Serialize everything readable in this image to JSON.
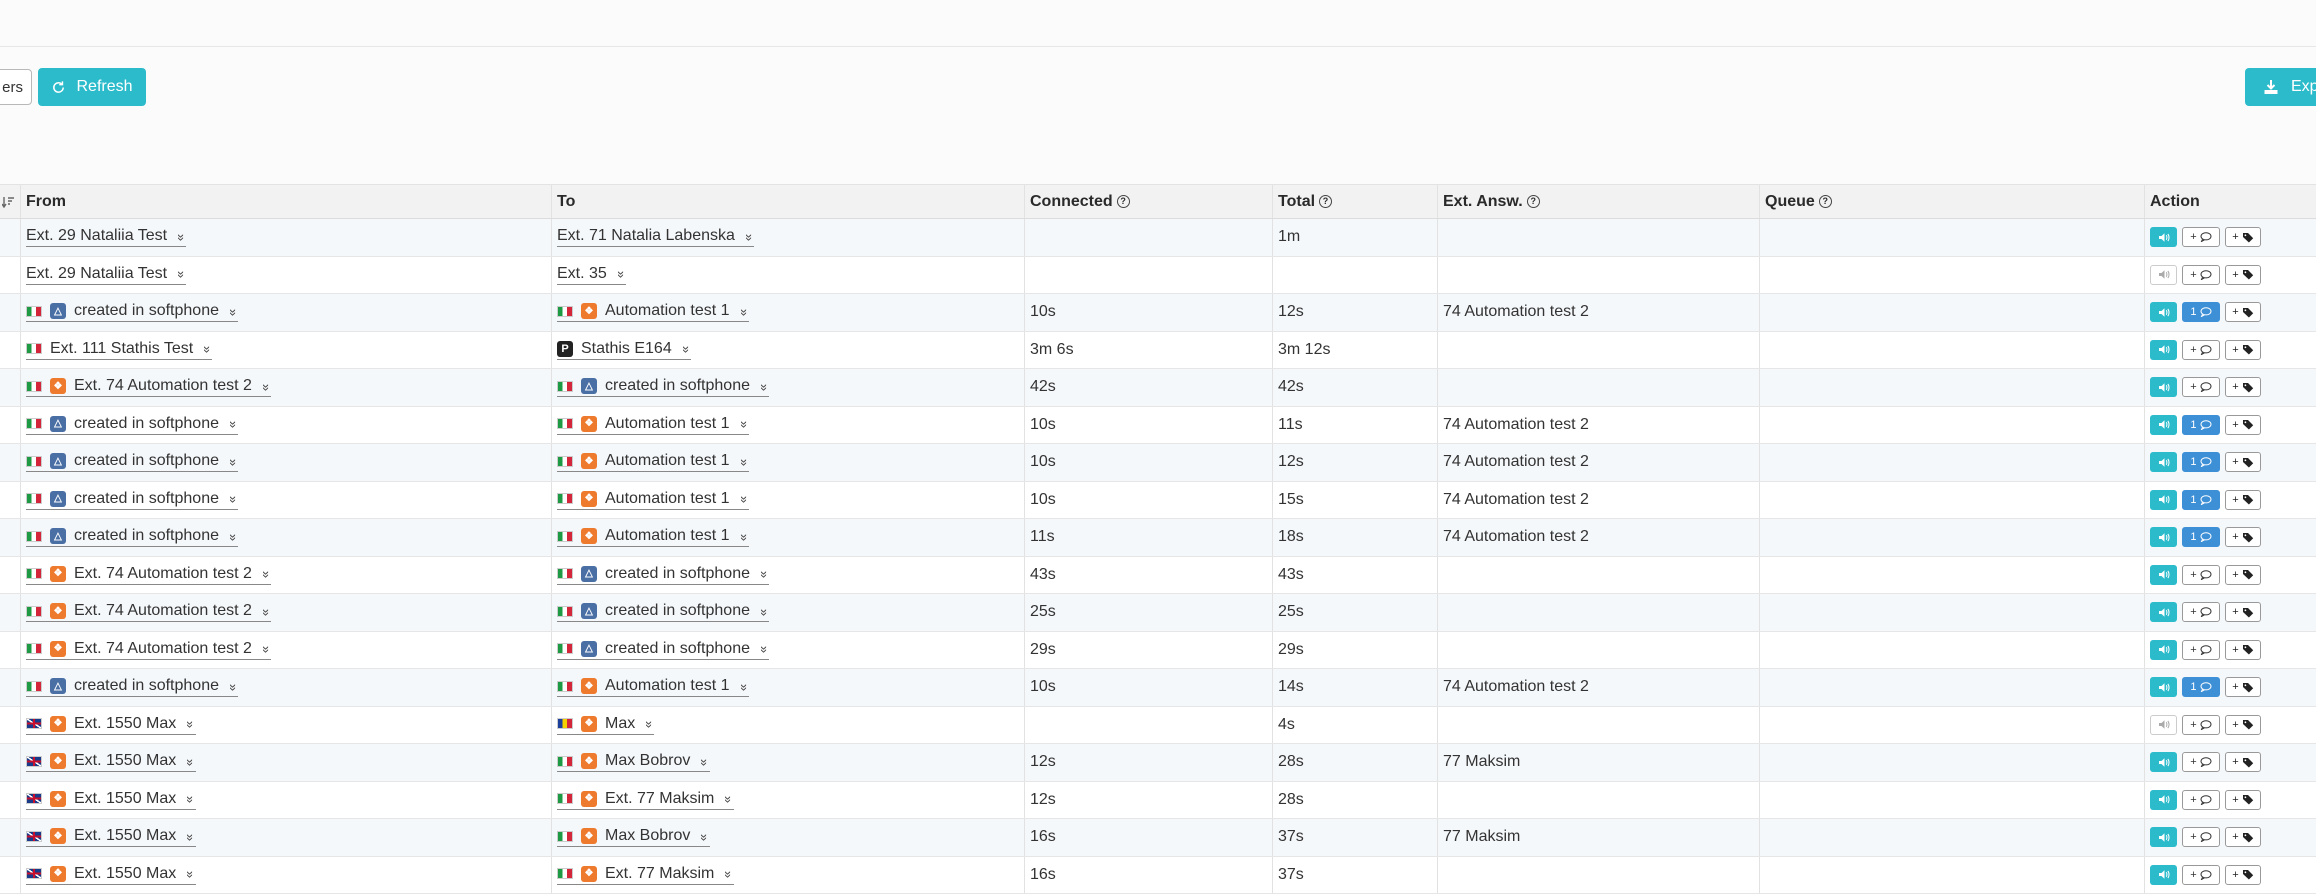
{
  "toolbar": {
    "filters_label": "ers",
    "refresh_label": "Refresh",
    "export_label": "Expo"
  },
  "table": {
    "headers": [
      "From",
      "To",
      "Connected",
      "Total",
      "Ext. Answ.",
      "Queue",
      "Action"
    ],
    "rows": [
      {
        "from_flag": "",
        "from_app": "",
        "from": "Ext. 29 Nataliia Test",
        "to_flag": "",
        "to_app": "",
        "to": "Ext. 71 Natalia Labenska",
        "connected": "",
        "total": "1m",
        "ext_answ": "",
        "queue": "",
        "play": "on",
        "note": "+",
        "tag": "+"
      },
      {
        "from_flag": "",
        "from_app": "",
        "from": "Ext. 29 Nataliia Test",
        "to_flag": "",
        "to_app": "",
        "to": "Ext. 35",
        "connected": "",
        "total": "",
        "ext_answ": "",
        "queue": "",
        "play": "off",
        "note": "+",
        "tag": "+"
      },
      {
        "from_flag": "it",
        "from_app": "blue",
        "from": "created in softphone",
        "to_flag": "it",
        "to_app": "orange",
        "to": "Automation test 1",
        "connected": "10s",
        "total": "12s",
        "ext_answ": "74 Automation test 2",
        "queue": "",
        "play": "on",
        "note": "1",
        "tag": "+"
      },
      {
        "from_flag": "it",
        "from_app": "",
        "from": "Ext. 111 Stathis Test",
        "to_flag": "",
        "to_app": "black",
        "to": "Stathis E164",
        "connected": "3m 6s",
        "total": "3m 12s",
        "ext_answ": "",
        "queue": "",
        "play": "on",
        "note": "+",
        "tag": "+"
      },
      {
        "from_flag": "it",
        "from_app": "orange",
        "from": "Ext. 74 Automation test 2",
        "to_flag": "it",
        "to_app": "blue",
        "to": "created in softphone",
        "connected": "42s",
        "total": "42s",
        "ext_answ": "",
        "queue": "",
        "play": "on",
        "note": "+",
        "tag": "+"
      },
      {
        "from_flag": "it",
        "from_app": "blue",
        "from": "created in softphone",
        "to_flag": "it",
        "to_app": "orange",
        "to": "Automation test 1",
        "connected": "10s",
        "total": "11s",
        "ext_answ": "74 Automation test 2",
        "queue": "",
        "play": "on",
        "note": "1",
        "tag": "+"
      },
      {
        "from_flag": "it",
        "from_app": "blue",
        "from": "created in softphone",
        "to_flag": "it",
        "to_app": "orange",
        "to": "Automation test 1",
        "connected": "10s",
        "total": "12s",
        "ext_answ": "74 Automation test 2",
        "queue": "",
        "play": "on",
        "note": "1",
        "tag": "+"
      },
      {
        "from_flag": "it",
        "from_app": "blue",
        "from": "created in softphone",
        "to_flag": "it",
        "to_app": "orange",
        "to": "Automation test 1",
        "connected": "10s",
        "total": "15s",
        "ext_answ": "74 Automation test 2",
        "queue": "",
        "play": "on",
        "note": "1",
        "tag": "+"
      },
      {
        "from_flag": "it",
        "from_app": "blue",
        "from": "created in softphone",
        "to_flag": "it",
        "to_app": "orange",
        "to": "Automation test 1",
        "connected": "11s",
        "total": "18s",
        "ext_answ": "74 Automation test 2",
        "queue": "",
        "play": "on",
        "note": "1",
        "tag": "+"
      },
      {
        "from_flag": "it",
        "from_app": "orange",
        "from": "Ext. 74 Automation test 2",
        "to_flag": "it",
        "to_app": "blue",
        "to": "created in softphone",
        "connected": "43s",
        "total": "43s",
        "ext_answ": "",
        "queue": "",
        "play": "on",
        "note": "+",
        "tag": "+"
      },
      {
        "from_flag": "it",
        "from_app": "orange",
        "from": "Ext. 74 Automation test 2",
        "to_flag": "it",
        "to_app": "blue",
        "to": "created in softphone",
        "connected": "25s",
        "total": "25s",
        "ext_answ": "",
        "queue": "",
        "play": "on",
        "note": "+",
        "tag": "+"
      },
      {
        "from_flag": "it",
        "from_app": "orange",
        "from": "Ext. 74 Automation test 2",
        "to_flag": "it",
        "to_app": "blue",
        "to": "created in softphone",
        "connected": "29s",
        "total": "29s",
        "ext_answ": "",
        "queue": "",
        "play": "on",
        "note": "+",
        "tag": "+"
      },
      {
        "from_flag": "it",
        "from_app": "blue",
        "from": "created in softphone",
        "to_flag": "it",
        "to_app": "orange",
        "to": "Automation test 1",
        "connected": "10s",
        "total": "14s",
        "ext_answ": "74 Automation test 2",
        "queue": "",
        "play": "on",
        "note": "1",
        "tag": "+"
      },
      {
        "from_flag": "gb",
        "from_app": "orange",
        "from": "Ext. 1550 Max",
        "to_flag": "md",
        "to_app": "orange",
        "to": "Max",
        "connected": "",
        "total": "4s",
        "ext_answ": "",
        "queue": "",
        "play": "off",
        "note": "+",
        "tag": "+"
      },
      {
        "from_flag": "gb",
        "from_app": "orange",
        "from": "Ext. 1550 Max",
        "to_flag": "it",
        "to_app": "orange",
        "to": "Max Bobrov",
        "connected": "12s",
        "total": "28s",
        "ext_answ": "77 Maksim",
        "queue": "",
        "play": "on",
        "note": "+",
        "tag": "+"
      },
      {
        "from_flag": "gb",
        "from_app": "orange",
        "from": "Ext. 1550 Max",
        "to_flag": "it",
        "to_app": "orange",
        "to": "Ext. 77 Maksim",
        "connected": "12s",
        "total": "28s",
        "ext_answ": "",
        "queue": "",
        "play": "on",
        "note": "+",
        "tag": "+"
      },
      {
        "from_flag": "gb",
        "from_app": "orange",
        "from": "Ext. 1550 Max",
        "to_flag": "it",
        "to_app": "orange",
        "to": "Max Bobrov",
        "connected": "16s",
        "total": "37s",
        "ext_answ": "77 Maksim",
        "queue": "",
        "play": "on",
        "note": "+",
        "tag": "+"
      },
      {
        "from_flag": "gb",
        "from_app": "orange",
        "from": "Ext. 1550 Max",
        "to_flag": "it",
        "to_app": "orange",
        "to": "Ext. 77 Maksim",
        "connected": "16s",
        "total": "37s",
        "ext_answ": "",
        "queue": "",
        "play": "on",
        "note": "+",
        "tag": "+"
      }
    ]
  }
}
